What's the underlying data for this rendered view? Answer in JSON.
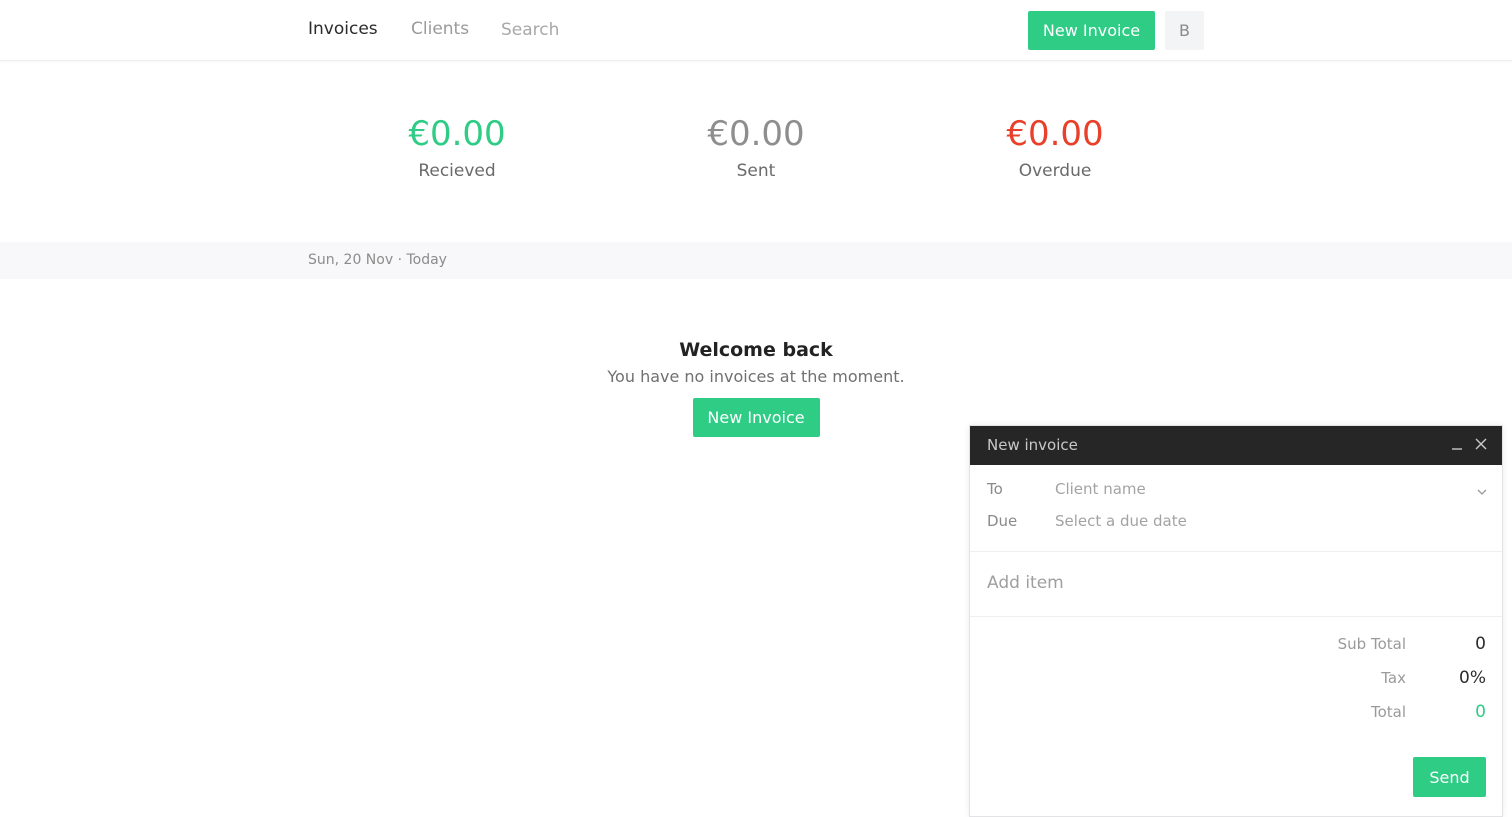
{
  "nav": {
    "invoices_label": "Invoices",
    "clients_label": "Clients",
    "search_placeholder": "Search",
    "new_invoice_label": "New Invoice",
    "avatar_initial": "B"
  },
  "stats": [
    {
      "amount": "€0.00",
      "label": "Recieved",
      "color": "#2ecc85"
    },
    {
      "amount": "€0.00",
      "label": "Sent",
      "color": "#8e8e8e"
    },
    {
      "amount": "€0.00",
      "label": "Overdue",
      "color": "#e8402a"
    }
  ],
  "date_strip": {
    "text": "Sun, 20 Nov · Today"
  },
  "welcome": {
    "title": "Welcome back",
    "subtitle": "You have no invoices at the moment.",
    "button_label": "New Invoice"
  },
  "panel": {
    "title": "New invoice",
    "to_label": "To",
    "to_placeholder": "Client name",
    "due_label": "Due",
    "due_placeholder": "Select a due date",
    "add_item_placeholder": "Add item",
    "subtotal_label": "Sub Total",
    "subtotal_value": "0",
    "tax_label": "Tax",
    "tax_value": "0%",
    "total_label": "Total",
    "total_value": "0",
    "send_label": "Send"
  },
  "colors": {
    "brand_green": "#2ecc85",
    "overdue_red": "#e8402a",
    "panel_header": "#262626"
  },
  "icons": {
    "minimize": "minimize-icon",
    "close": "close-icon",
    "chevron": "chevron-down-icon"
  }
}
